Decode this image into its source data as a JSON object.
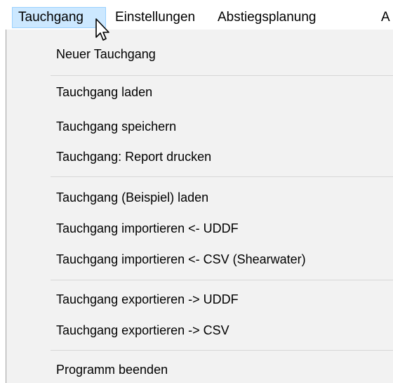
{
  "menubar": {
    "items": [
      {
        "label": "Tauchgang"
      },
      {
        "label": "Einstellungen"
      },
      {
        "label": "Abstiegsplanung"
      },
      {
        "label": "A"
      }
    ]
  },
  "dropdown": {
    "items": [
      {
        "label": "Neuer Tauchgang"
      },
      {
        "label": "Tauchgang laden"
      },
      {
        "label": "Tauchgang speichern"
      },
      {
        "label": "Tauchgang: Report drucken"
      },
      {
        "label": "Tauchgang (Beispiel) laden"
      },
      {
        "label": "Tauchgang importieren <- UDDF"
      },
      {
        "label": "Tauchgang importieren <- CSV (Shearwater)"
      },
      {
        "label": "Tauchgang exportieren -> UDDF"
      },
      {
        "label": "Tauchgang exportieren -> CSV"
      },
      {
        "label": "Programm beenden"
      }
    ]
  },
  "cursor": {
    "icon": "arrow-cursor-icon"
  }
}
